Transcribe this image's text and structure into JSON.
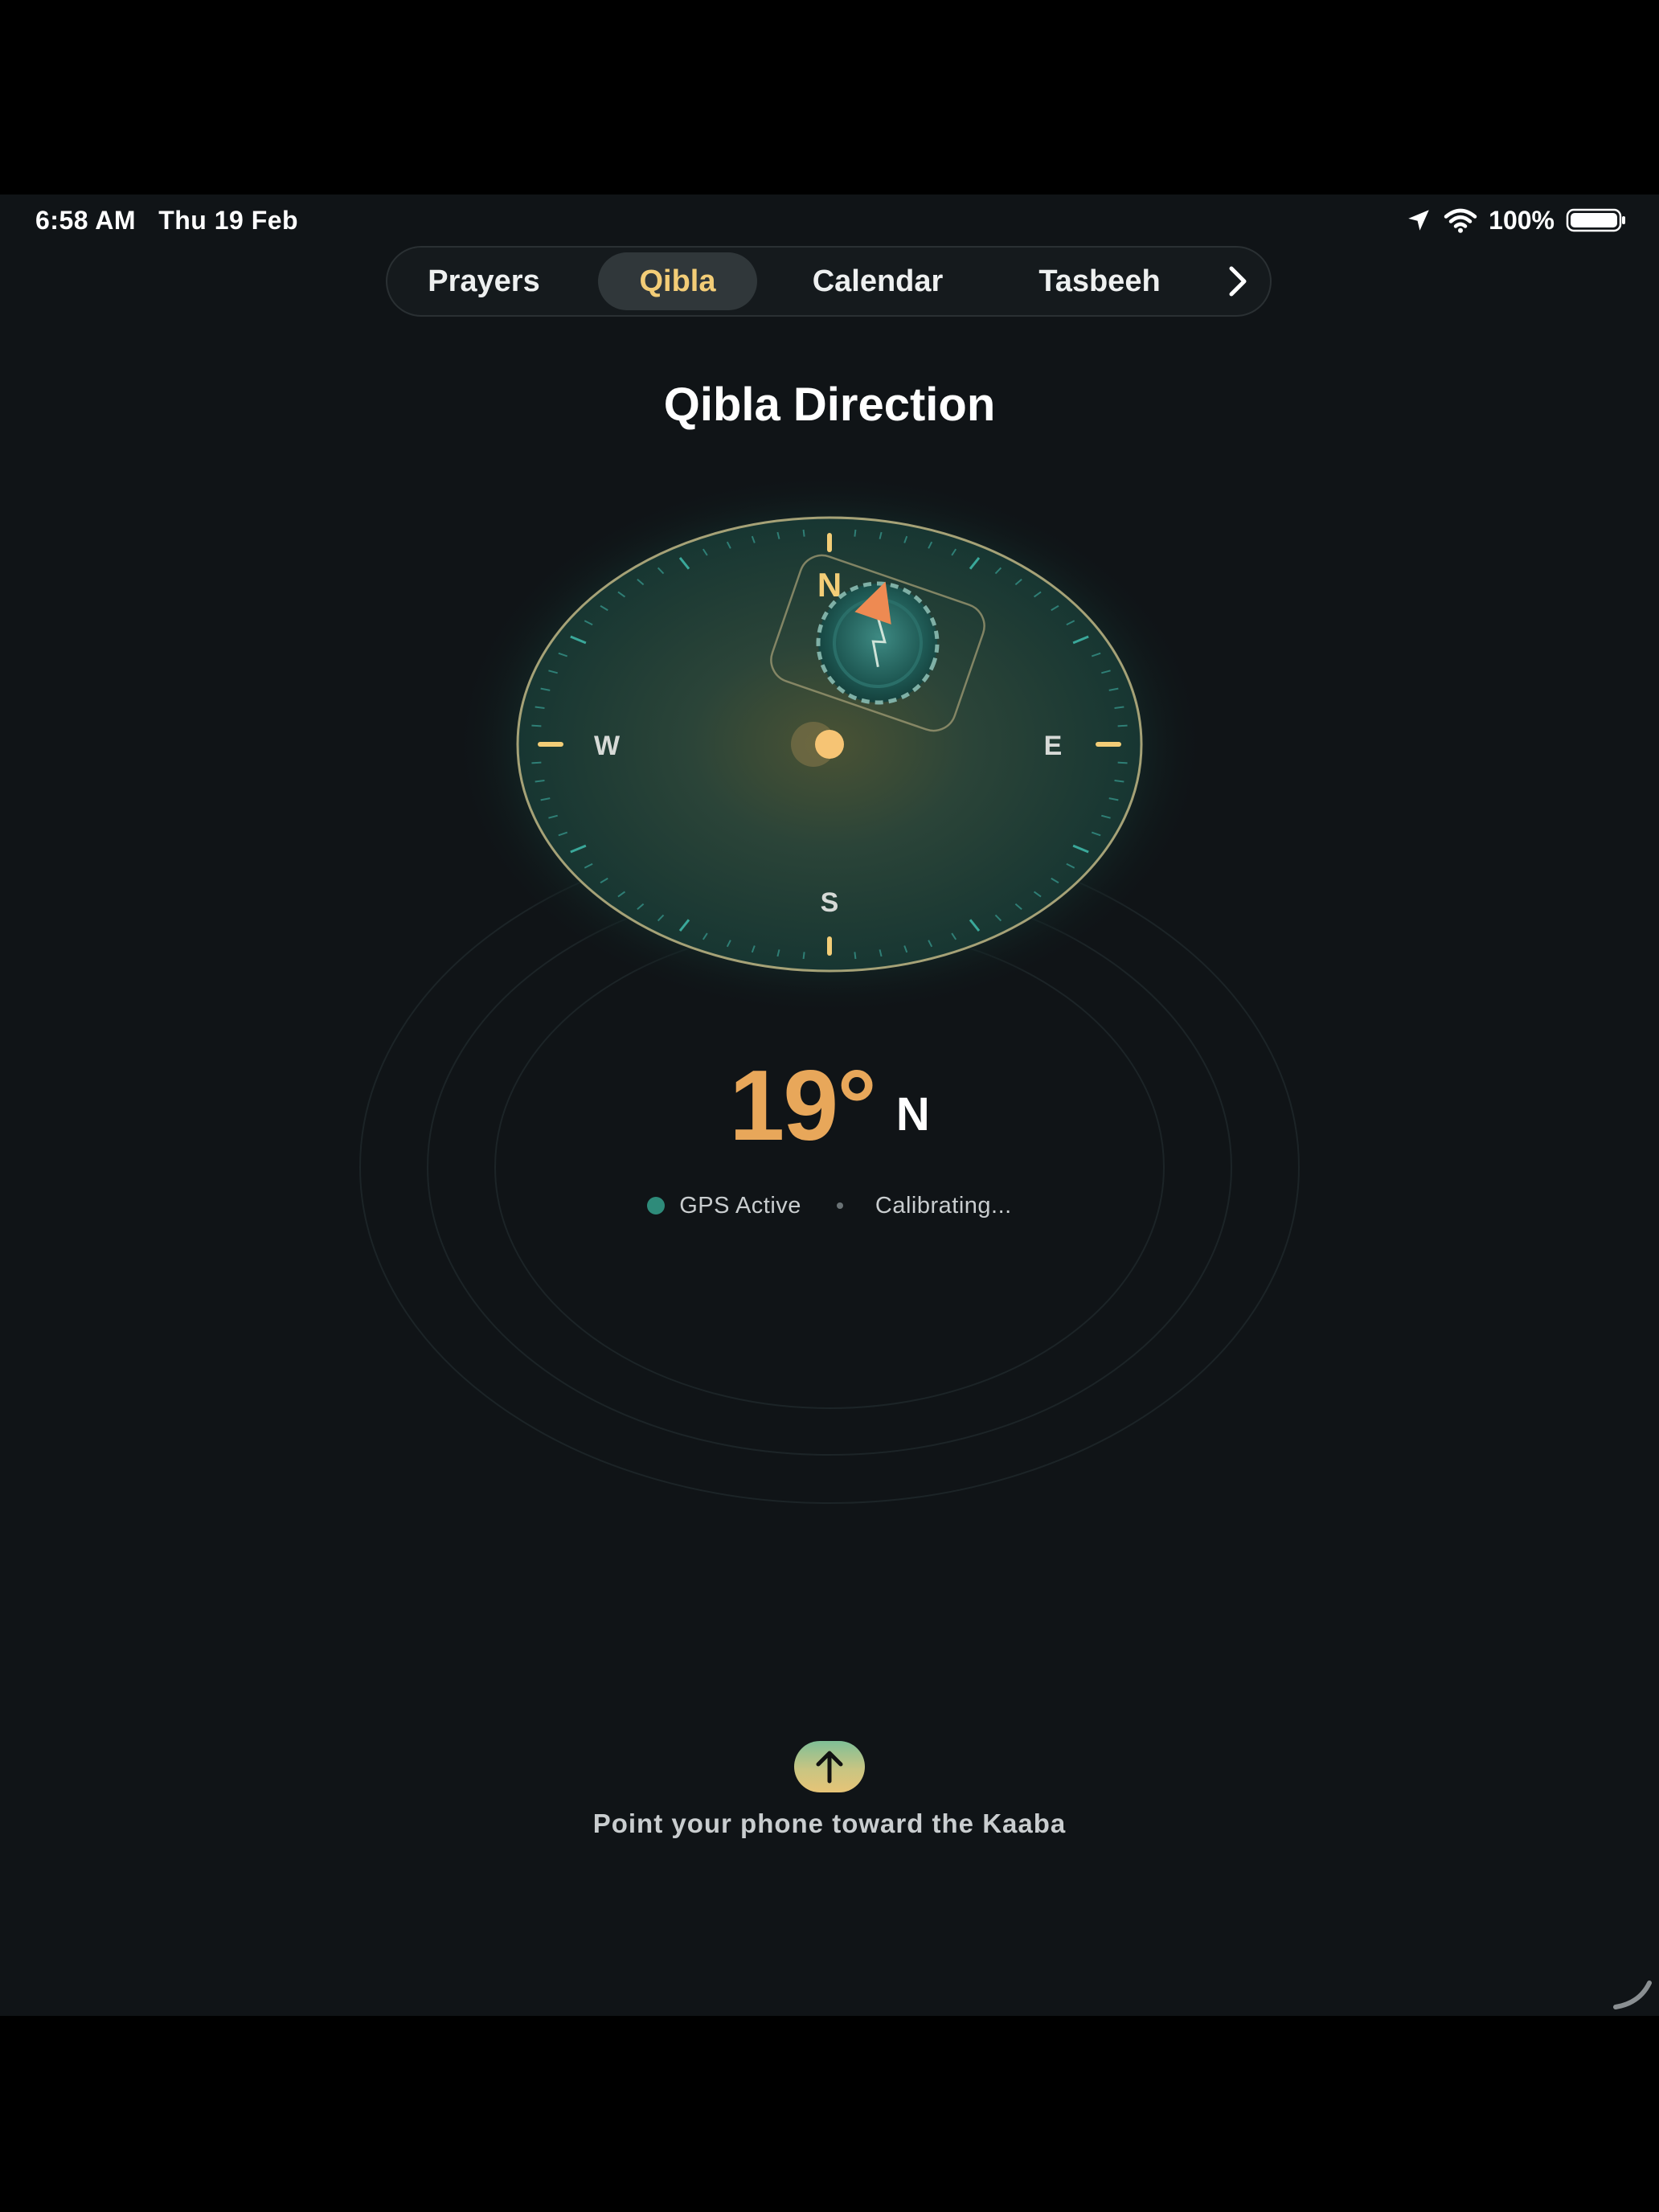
{
  "status_bar": {
    "time": "6:58 AM",
    "date": "Thu 19 Feb",
    "battery_percent": "100%",
    "icons": [
      "location-arrow-icon",
      "wifi-icon",
      "battery-icon"
    ]
  },
  "tabs": [
    {
      "label": "Prayers",
      "active": false
    },
    {
      "label": "Qibla",
      "active": true
    },
    {
      "label": "Calendar",
      "active": false
    },
    {
      "label": "Tasbeeh",
      "active": false
    }
  ],
  "tabs_more_icon": "chevron-right-icon",
  "page": {
    "title": "Qibla Direction"
  },
  "compass": {
    "north": "N",
    "south": "S",
    "east": "E",
    "west": "W",
    "needle_heading_deg": 19,
    "center_icon": "kaaba-emblem-icon"
  },
  "reading": {
    "degrees": "19°",
    "direction": "N"
  },
  "status": {
    "gps": "GPS Active",
    "calibration": "Calibrating..."
  },
  "hint": {
    "icon": "arrow-up-icon",
    "text": "Point your phone toward the Kaaba"
  },
  "colors": {
    "background": "#101417",
    "accent_gold": "#f3cd77",
    "degree_orange": "#e8a75a",
    "teal": "#2e8b7a"
  }
}
